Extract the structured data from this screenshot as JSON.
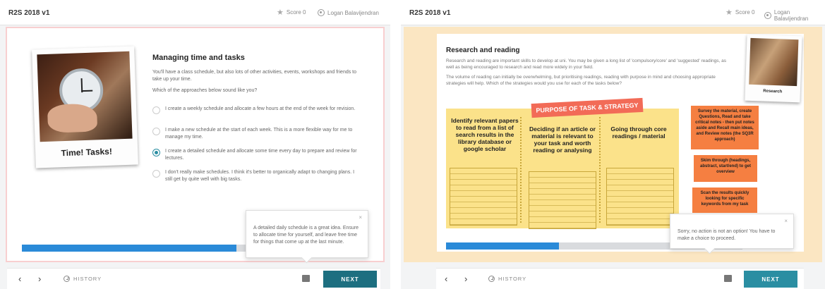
{
  "left": {
    "app_title": "R2S 2018 v1",
    "score": "Score 0",
    "user": "Logan Balavijendran",
    "image_caption": "Time! Tasks!",
    "question": {
      "title": "Managing time and tasks",
      "intro": "You'll have a class schedule, but also lots of other activities, events, workshops and friends to take up your time.",
      "prompt": "Which of the approaches below sound like you?",
      "options": [
        {
          "text": "I create a weekly schedule and allocate a few hours at the end of the week for revision.",
          "selected": false
        },
        {
          "text": "I make a new schedule at the start of each week. This is a more flexible way for me to manage my time.",
          "selected": false
        },
        {
          "text": "I create a detailed schedule and allocate some time every day to prepare and review for lectures.",
          "selected": true
        },
        {
          "text": "I don't really make schedules. I think it's better to organically adapt to changing plans. I still get by quite well with big tasks.",
          "selected": false
        }
      ]
    },
    "progress": 0.62,
    "tooltip": {
      "close": "×",
      "text": "A detailed daily schedule is a great idea. Ensure to allocate time for yourself, and leave free time for things that come up at the last minute."
    },
    "footer": {
      "prev": "‹",
      "next_arrow": "›",
      "history": "HISTORY",
      "next": "NEXT"
    }
  },
  "right": {
    "app_title": "R2S 2018 v1",
    "score": "Score 0",
    "user": "Logan Balavijendran",
    "title": "Research and reading",
    "intro_1": "Research and reading are important skills to develop at uni. You may be given a long list of 'compulsory/core' and 'suggested' readings, as well as being encouraged to research and read more widely in your field.",
    "intro_2": "The volume of reading can initially be overwhelming, but prioritising readings, reading with purpose in mind and choosing appropriate strategies will help. Which of the strategies would you use for each of the tasks below?",
    "image_caption": "Research",
    "banner": "PURPOSE OF TASK & STRATEGY",
    "columns": [
      "Identify relevant papers to read from a list of search results in the library database or google scholar",
      "Deciding if an article or material is relevant to your task and worth reading or analysing",
      "Going through core readings / material"
    ],
    "stickies": [
      "Survey the material, create Questions, Read and take critical notes - then put notes aside and Recall main ideas, and Review notes (the SQ3R approach)",
      "Skim through (headings, abstract, start/end) to get overview",
      "Scan the results quickly looking for specific keywords from my task"
    ],
    "progress": 0.38,
    "tooltip": {
      "close": "×",
      "text": "Sorry, no action is not an option! You have to make a choice to proceed."
    },
    "footer": {
      "prev": "‹",
      "next_arrow": "›",
      "history": "HISTORY",
      "next": "NEXT"
    }
  }
}
